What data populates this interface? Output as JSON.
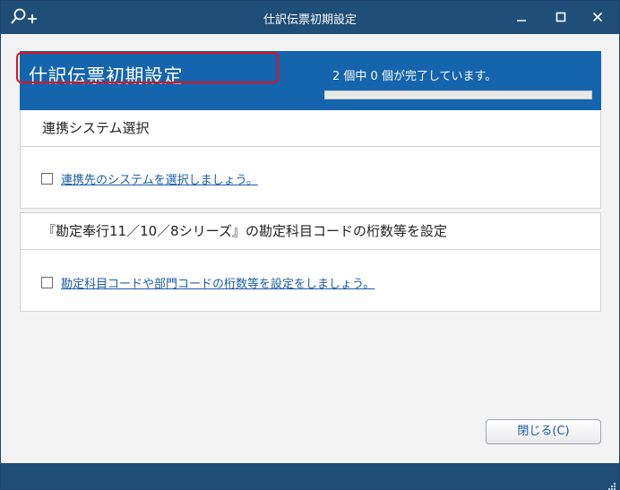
{
  "window": {
    "title": "仕訳伝票初期設定",
    "controls": {
      "minimize": "_",
      "maximize": "☐",
      "close": "✕"
    }
  },
  "banner": {
    "heading": "仕訳伝票初期設定",
    "progress_text": "2 個中 0 個が完了しています。",
    "progress_completed": 0,
    "progress_total": 2
  },
  "sections": [
    {
      "header": "連携システム選択",
      "task": {
        "label": "連携先のシステムを選択しましょう。",
        "checked": false
      }
    },
    {
      "header": "『勘定奉行11／10／8シリーズ』の勘定科目コードの桁数等を設定",
      "task": {
        "label": "勘定科目コードや部門コードの桁数等を設定をしましょう。",
        "checked": false
      }
    }
  ],
  "footer": {
    "close_button": "閉じる(C)"
  },
  "colors": {
    "titlebar": "#1f4e79",
    "banner": "#1464ae",
    "link": "#1a5ca8",
    "highlight": "#e0121d"
  },
  "icons": {
    "app": "search-plus-icon"
  }
}
